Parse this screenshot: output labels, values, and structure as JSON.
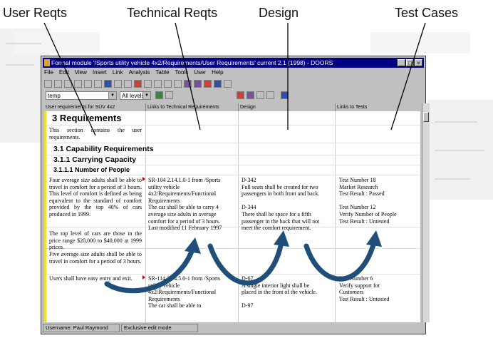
{
  "callouts": {
    "user": "User Reqts",
    "technical": "Technical Reqts",
    "design": "Design",
    "test": "Test Cases"
  },
  "window": {
    "title": "Formal module '/Sports utility vehicle 4x2/Requirements/User Requirements' current 2.1 (1998) - DOORS",
    "minimize": "_",
    "maximize": "□",
    "close": "×"
  },
  "menu": [
    "File",
    "Edit",
    "View",
    "Insert",
    "Link",
    "Analysis",
    "Table",
    "Tools",
    "User",
    "Help"
  ],
  "toolbar": {
    "view_value": "temp",
    "levels_value": "All levels"
  },
  "columns": [
    "User requirements for SUV 4x2",
    "Links to Technical Requirements",
    "Design",
    "Links to Tests"
  ],
  "doc": {
    "h1": "3 Requirements",
    "intro": "This section contains the user requirements.",
    "h2": "3.1 Capability Requirements",
    "h3a": "3.1.1 Carrying Capacity",
    "h3b": "3.1.1.1 Number of People",
    "row1": {
      "user": "Four average size adults shall be able to travel in comfort for a period of 3 hours. This level of comfort is defined as being equivalent to the standard of comfort provided by the top 40% of cars produced in 1999.",
      "tech": [
        "SR-104 2.14.1.0-1 from /Sports",
        "utility vehicle",
        "4x2/Requirements/Functional",
        "Requirements",
        "The car shall be able to carry 4",
        "average size adults in average",
        "comfort for a period of 3 hours.",
        "Last modified 11 February 1997"
      ],
      "design": [
        "D-342",
        "Full seats shall be created for two",
        "passengers in both front and back.",
        "",
        "D-344",
        "There shall be space for a fifth",
        "passenger in the back that will not",
        "meet the comfort requirement."
      ],
      "test": [
        "Test Number 18",
        "Market Research",
        "Test Result : Passed",
        "",
        "Test Number 12",
        "Verify Number of People",
        "Test Result : Untested"
      ]
    },
    "row2": {
      "user": "The top level of cars are those in the price range $20,000 to $40,000 at 1999 prices.",
      "user2": "Five average size adults shall be able to travel in comfort for a period of 3 hours."
    },
    "row3": {
      "user": "Users shall have easy entry and exit.",
      "tech": [
        "SR-114 2.14.5.0-1 from /Sports",
        "utility vehicle",
        "4x2/Requirements/Functional",
        "Requirements",
        "The car shall be able to"
      ],
      "design": [
        "D-67",
        "A single interior light shall be",
        "placed in the front of the vehicle.",
        "",
        "D-97"
      ],
      "test": [
        "Test Number 6",
        "Verify support for",
        "Customers",
        "Test Result : Untested"
      ]
    }
  },
  "status": {
    "user": "Username: Paul Raymond",
    "mode": "Exclusive edit mode"
  },
  "colors": {
    "title_bar": "#000080",
    "arrow": "#1f4e79",
    "accent_bar": "#f2df2a"
  }
}
